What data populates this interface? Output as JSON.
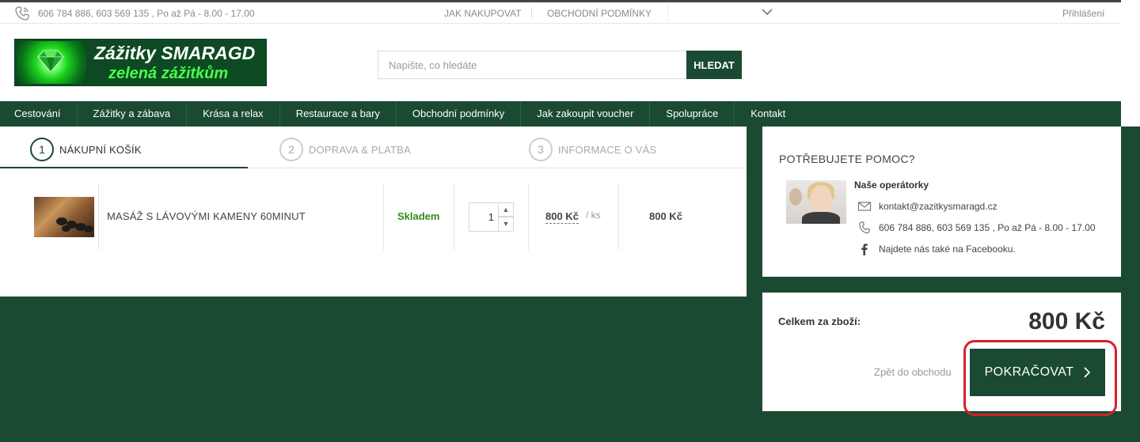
{
  "topbar": {
    "phone_icon": "phone-icon",
    "contact": "606 784 886, 603 569 135 , Po až Pá - 8.00 - 17.00",
    "nav": [
      "JAK NAKUPOVAT",
      "OBCHODNÍ PODMÍNKY"
    ],
    "more_icon": "chevron-down-icon",
    "login": "Přihlášení"
  },
  "logo": {
    "line1": "Zážitky SMARAGD",
    "line2": "zelená zážitkům"
  },
  "search": {
    "placeholder": "Napište, co hledáte",
    "value": "",
    "button": "HLEDAT"
  },
  "main_nav": {
    "items": [
      "Cestování",
      "Zážitky a zábava",
      "Krása a relax",
      "Restaurace a bary",
      "Obchodní podmínky",
      "Jak zakoupit voucher",
      "Spolupráce",
      "Kontakt"
    ]
  },
  "steps": [
    {
      "num": "1",
      "label": "NÁKUPNÍ KOŠÍK",
      "active": true
    },
    {
      "num": "2",
      "label": "DOPRAVA & PLATBA",
      "active": false
    },
    {
      "num": "3",
      "label": "INFORMACE O VÁS",
      "active": false
    }
  ],
  "cart": {
    "items": [
      {
        "name": "MASÁŽ S LÁVOVÝMI KAMENY 60MINUT",
        "availability": "Skladem",
        "quantity": "1",
        "unit_price": "800 Kč",
        "unit_suffix": "/ ks",
        "total": "800 Kč"
      }
    ]
  },
  "help": {
    "title": "POTŘEBUJETE POMOC?",
    "subtitle": "Naše operátorky",
    "email": "kontakt@zazitkysmaragd.cz",
    "phone": "606 784 886, 603 569 135 , Po až Pá - 8.00 - 17.00",
    "facebook": "Najdete nás také na Facebooku.",
    "icons": [
      "envelope-icon",
      "phone-icon",
      "facebook-icon"
    ]
  },
  "summary": {
    "label": "Celkem za zboží:",
    "total": "800 Kč",
    "back": "Zpět do obchodu",
    "continue": "POKRAČOVAT"
  },
  "colors": {
    "brand_green": "#1a4a32",
    "stock_green": "#2e8b1e",
    "highlight_red": "#d8202a"
  }
}
